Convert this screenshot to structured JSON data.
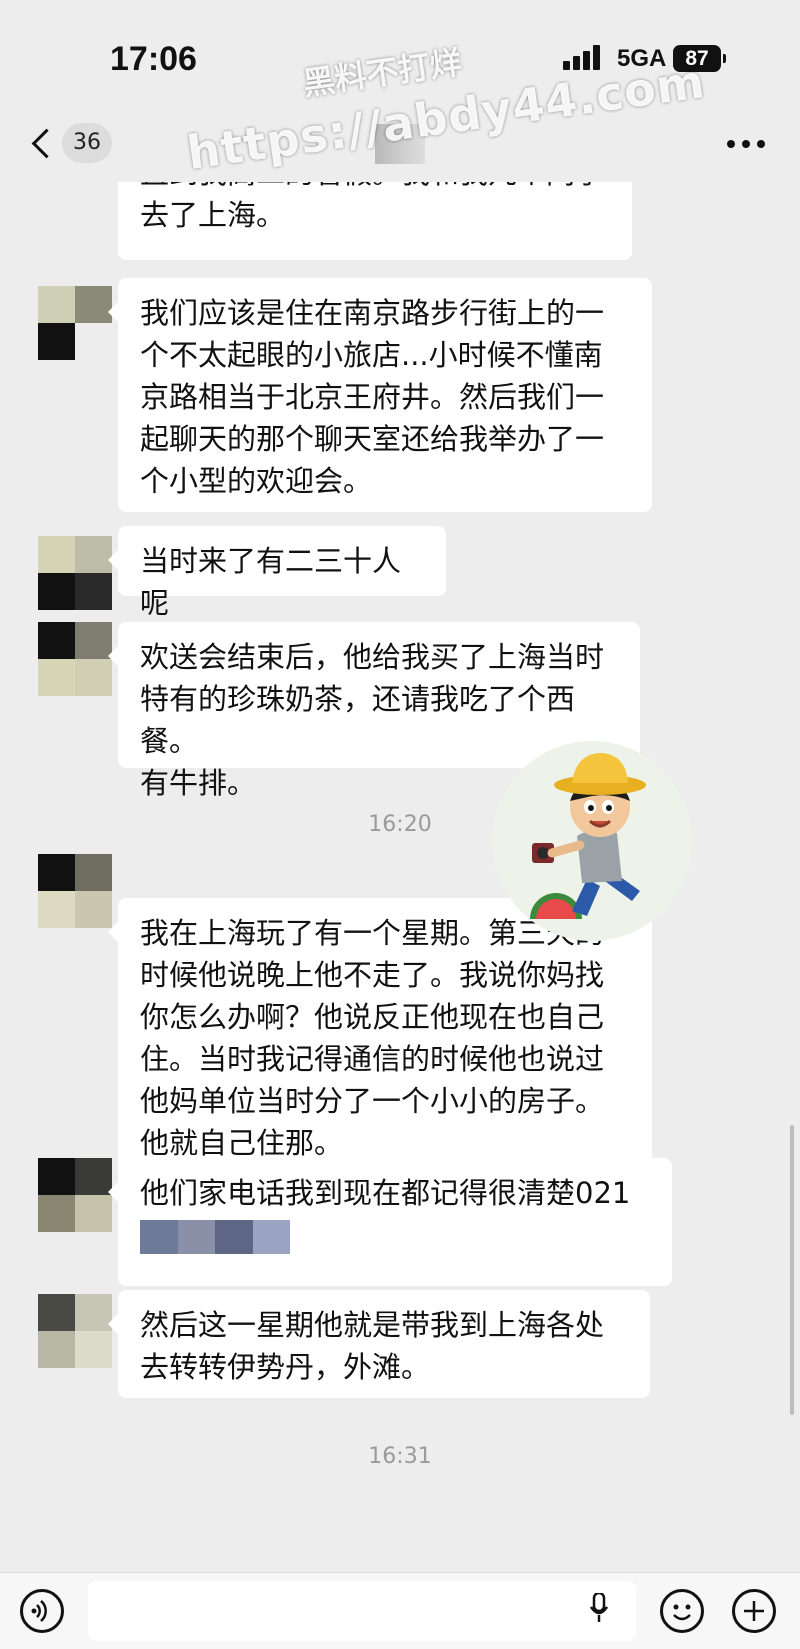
{
  "status_bar": {
    "time": "17:06",
    "network": "5GA",
    "battery": "87"
  },
  "nav": {
    "unread_count": "36"
  },
  "watermark": {
    "line1": "黑料不打烊",
    "line2": "https://abdy44.com"
  },
  "messages": [
    {
      "text": "直到我高二的暑假。我和我几个同学\n去了上海。"
    },
    {
      "text": "我们应该是住在南京路步行街上的一\n个不太起眼的小旅店...小时候不懂南\n京路相当于北京王府井。然后我们一\n起聊天的那个聊天室还给我举办了一\n个小型的欢迎会。"
    },
    {
      "text": "当时来了有二三十人呢"
    },
    {
      "text": "欢送会结束后，他给我买了上海当时\n特有的珍珠奶茶，还请我吃了个西餐。\n有牛排。"
    },
    {
      "text": "我在上海玩了有一个星期。第三天的\n时候他说晚上他不走了。我说你妈找\n你怎么办啊？他说反正他现在也自己\n住。当时我记得通信的时候他也说过\n他妈单位当时分了一个小小的房子。\n他就自己住那。"
    },
    {
      "text": "他们家电话我到现在都记得很清楚021"
    },
    {
      "text": "然后这一星期他就是带我到上海各处\n去转转伊势丹，外滩。"
    }
  ],
  "timestamps": [
    "16:20",
    "16:31"
  ],
  "icons": {
    "back": "chevron-left-icon",
    "more": "more-dots-icon",
    "voice": "voice-icon",
    "mic": "microphone-icon",
    "emoji": "emoji-icon",
    "plus": "plus-icon"
  },
  "colors": {
    "background": "#ededed",
    "bubble": "#ffffff",
    "timestamp": "#9a9a9a"
  }
}
